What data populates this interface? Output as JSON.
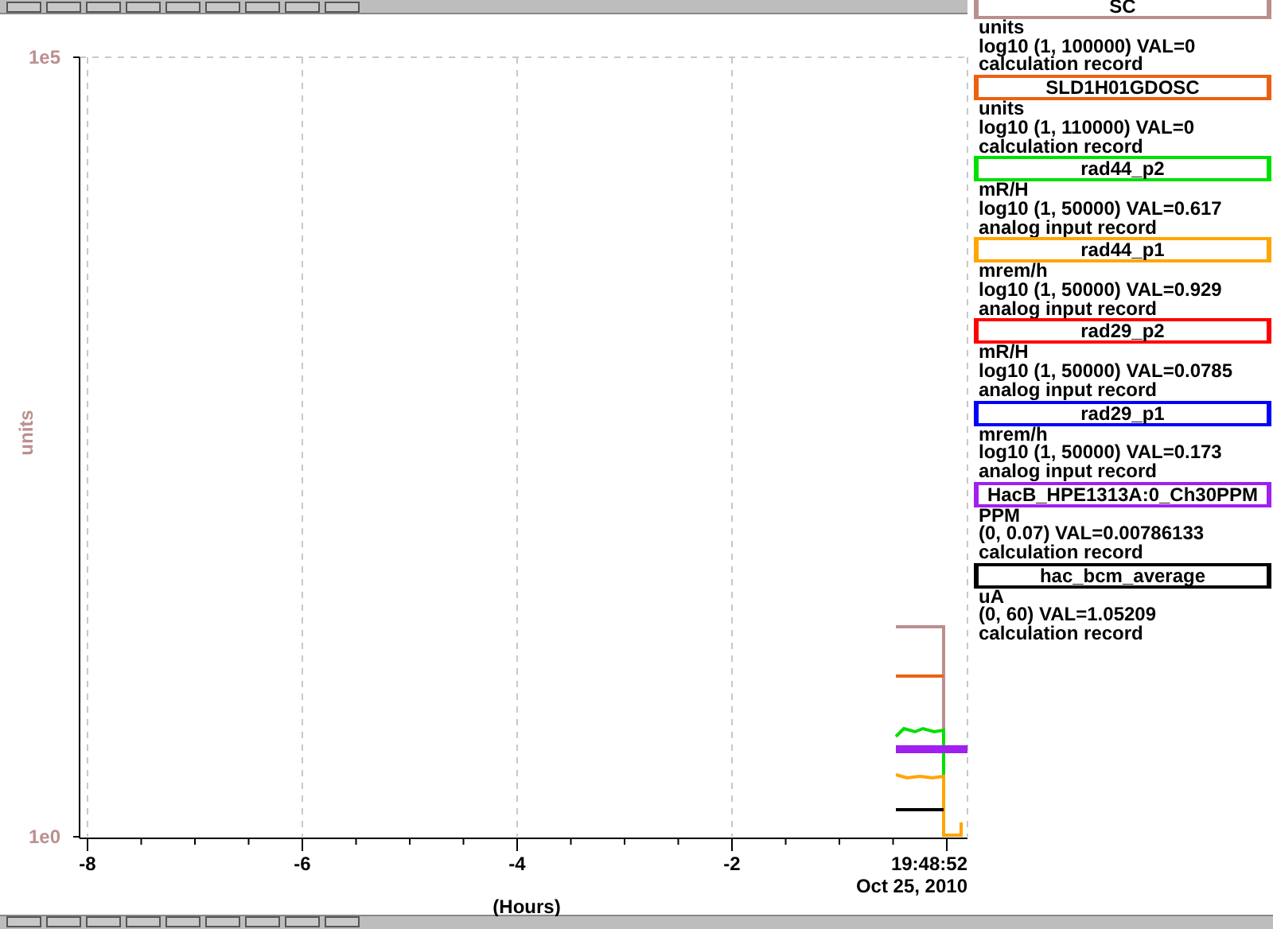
{
  "legend": [
    {
      "name": "SC",
      "color": "#bc8f8f",
      "units": "units",
      "range": "log10 (1, 100000) VAL=0",
      "record": "calculation record"
    },
    {
      "name": "SLD1H01GDOSC",
      "color": "#ee6010",
      "units": "units",
      "range": "log10 (1, 110000) VAL=0",
      "record": "calculation record"
    },
    {
      "name": "rad44_p2",
      "color": "#00e000",
      "units": "mR/H",
      "range": "log10 (1, 50000) VAL=0.617",
      "record": "analog input record"
    },
    {
      "name": "rad44_p1",
      "color": "#ffa500",
      "units": "mrem/h",
      "range": "log10 (1, 50000) VAL=0.929",
      "record": "analog input record"
    },
    {
      "name": "rad29_p2",
      "color": "#ff0000",
      "units": "mR/H",
      "range": "log10 (1, 50000) VAL=0.0785",
      "record": "analog input record"
    },
    {
      "name": "rad29_p1",
      "color": "#0000ff",
      "units": "mrem/h",
      "range": "log10 (1, 50000) VAL=0.173",
      "record": "analog input record"
    },
    {
      "name": "HacB_HPE1313A:0_Ch30PPM",
      "color": "#a020f0",
      "units": "PPM",
      "range": "(0, 0.07) VAL=0.00786133",
      "record": "calculation record"
    },
    {
      "name": "hac_bcm_average",
      "color": "#000000",
      "units": "uA",
      "range": "(0, 60) VAL=1.05209",
      "record": "calculation record"
    }
  ],
  "plot": {
    "ylabel": "units",
    "y_tick_labels": [
      "1e5",
      "1e0"
    ],
    "x_tick_labels": [
      "-8",
      "-6",
      "-4",
      "-2"
    ],
    "time": "19:48:52",
    "date": "Oct 25, 2010",
    "xlabel": "(Hours)"
  }
}
